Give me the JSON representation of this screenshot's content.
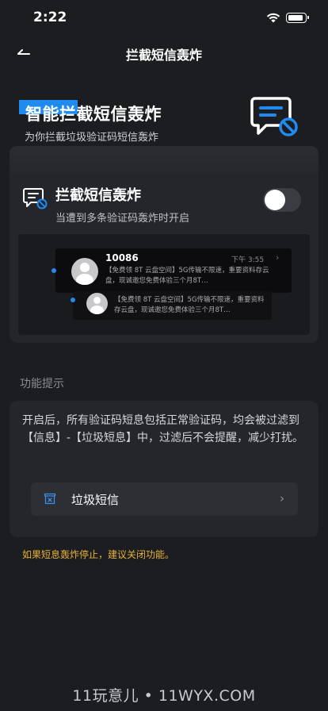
{
  "status_bar": {
    "time": "2:22"
  },
  "nav": {
    "title": "拦截短信轰炸"
  },
  "hero": {
    "title": "智能拦截短信轰炸",
    "subtitle": "为你拦截垃圾验证码短信轰炸"
  },
  "feature": {
    "title": "拦截短信轰炸",
    "subtitle": "当遭到多条验证码轰炸时开启",
    "toggle_on": false
  },
  "preview": {
    "message1": {
      "sender": "10086",
      "time": "下午 3:55",
      "text": "【免费领 8T 云盘空间】5G传输不限速，重要资料存云盘，现诚邀您免费体验三个月8T…"
    },
    "message2": {
      "text": "【免费领 8T 云盘空间】5G传输不限速，重要资料存云盘，现诚邀您免费体验三个月8T…"
    }
  },
  "tips": {
    "section_label": "功能提示",
    "text": "开启后，所有验证码短息包括正常验证码，均会被过滤到【信息】-【垃圾短息】中，过滤后不会提醒，减少打扰。",
    "junk_label": "垃圾短信"
  },
  "warning": "如果短息轰炸停止，建议关闭功能。",
  "watermark": "11玩意儿 • 11WYX.COM",
  "colors": {
    "accent": "#1f8bf0",
    "warning": "#e6b13a",
    "background": "#1c1d21",
    "card": "#24262b"
  }
}
